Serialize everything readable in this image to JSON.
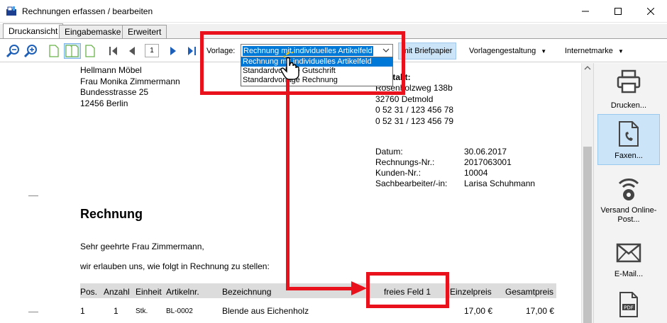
{
  "window": {
    "title": "Rechnungen erfassen / bearbeiten",
    "minimize": "—",
    "maximize": "☐",
    "close": "✕"
  },
  "tabs": [
    {
      "label": "Druckansicht",
      "active": true
    },
    {
      "label": "Eingabemaske",
      "active": false
    },
    {
      "label": "Erweitert",
      "active": false
    }
  ],
  "toolbar": {
    "page_number": "1",
    "vorlage_label": "Vorlage:",
    "vorlage_selected": "Rechnung mit individuelles Artikelfeld",
    "vorlage_options": [
      "Rechnung mit individuelles Artikelfeld",
      "Standardvorlage Gutschrift",
      "Standardvorlage Rechnung"
    ],
    "briefpapier_button": "mit Briefpapier",
    "vorlagengestaltung_menu": "Vorlagengestaltung",
    "internetmarke_menu": "Internetmarke"
  },
  "document": {
    "recipient": {
      "company": "Hellmann Möbel",
      "name": "Frau Monika Zimmermann",
      "street": "Bundesstrasse 25",
      "city": "12456 Berlin"
    },
    "contact": {
      "label": "ntakt:",
      "street": "Rosenholzweg 138b",
      "city": "32760 Detmold",
      "phone": "0 52 31 / 123 456 78",
      "fax": "0 52 31 / 123 456 79"
    },
    "meta": [
      {
        "label": "Datum:",
        "value": "30.06.2017"
      },
      {
        "label": "Rechnungs-Nr.:",
        "value": "2017063001"
      },
      {
        "label": "Kunden-Nr.:",
        "value": "10004"
      },
      {
        "label": "Sachbearbeiter/-in:",
        "value": "Larisa Schuhmann"
      }
    ],
    "heading": "Rechnung",
    "greeting": "Sehr geehrte Frau Zimmermann,",
    "intro": "wir erlauben uns, wie folgt in Rechnung zu stellen:",
    "table_headers": {
      "pos": "Pos.",
      "anzahl": "Anzahl",
      "einheit": "Einheit",
      "artikelnr": "Artikelnr.",
      "bezeichnung": "Bezeichnung",
      "freies_feld": "freies Feld 1",
      "einzelpreis": "Einzelpreis",
      "gesamtpreis": "Gesamtpreis"
    },
    "rows": [
      {
        "pos": "1",
        "anzahl": "1",
        "einheit": "Stk.",
        "artikelnr": "BL-0002",
        "bezeichnung": "Blende aus Eichenholz",
        "einzelpreis": "17,00 €",
        "gesamtpreis": "17,00 €"
      }
    ]
  },
  "sidebar": [
    {
      "label": "Drucken...",
      "icon": "printer-icon"
    },
    {
      "label": "Faxen...",
      "icon": "fax-icon"
    },
    {
      "label": "Versand Online-Post...",
      "icon": "online-post-icon"
    },
    {
      "label": "E-Mail...",
      "icon": "email-icon"
    },
    {
      "label": "",
      "icon": "pdf-icon"
    }
  ],
  "colors": {
    "accent": "#0078d7",
    "annotation": "#e8111c",
    "selected_bg": "#cce4f7"
  }
}
